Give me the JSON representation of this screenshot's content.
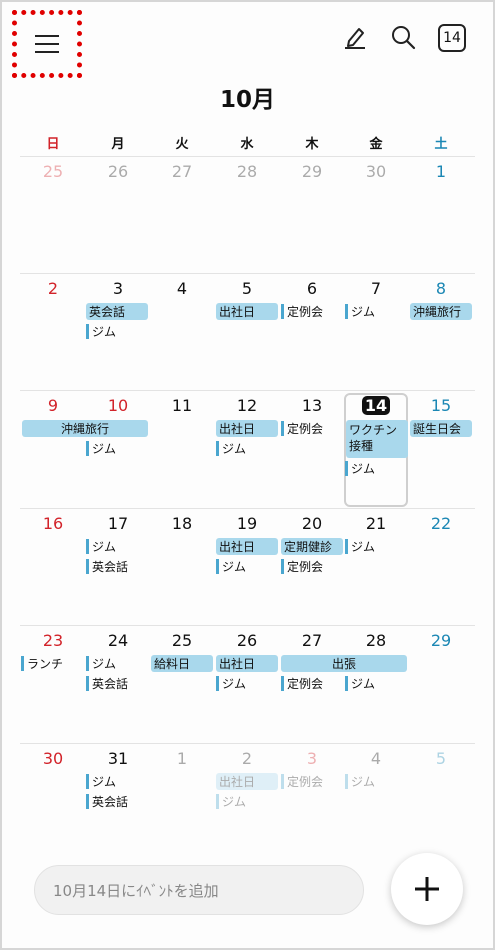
{
  "header": {
    "month_title": "10月",
    "today_button": "14"
  },
  "weekdays": [
    "日",
    "月",
    "火",
    "水",
    "木",
    "金",
    "土"
  ],
  "weeks": [
    [
      "25",
      "26",
      "27",
      "28",
      "29",
      "30",
      "1"
    ],
    [
      "2",
      "3",
      "4",
      "5",
      "6",
      "7",
      "8"
    ],
    [
      "9",
      "10",
      "11",
      "12",
      "13",
      "14",
      "15"
    ],
    [
      "16",
      "17",
      "18",
      "19",
      "20",
      "21",
      "22"
    ],
    [
      "23",
      "24",
      "25",
      "26",
      "27",
      "28",
      "29"
    ],
    [
      "30",
      "31",
      "1",
      "2",
      "3",
      "4",
      "5"
    ]
  ],
  "events": {
    "eikaiwa": "英会話",
    "gym": "ジム",
    "office": "出社日",
    "meeting": "定例会",
    "okinawa": "沖縄旅行",
    "vaccine": "ワクチン接種",
    "birthday": "誕生日会",
    "checkup": "定期健診",
    "lunch": "ランチ",
    "payday": "給料日",
    "business_trip": "出張"
  },
  "bottom": {
    "add_event_placeholder": "10月14日にｲﾍﾞﾝﾄを追加"
  },
  "colors": {
    "sunday": "#d2232a",
    "saturday": "#1b87b4",
    "event_bar": "#a9d8ec",
    "event_tick": "#4aa6cf",
    "highlight_border": "#e00000"
  },
  "icons": [
    "menu-icon",
    "edit-icon",
    "search-icon",
    "plus-icon"
  ]
}
